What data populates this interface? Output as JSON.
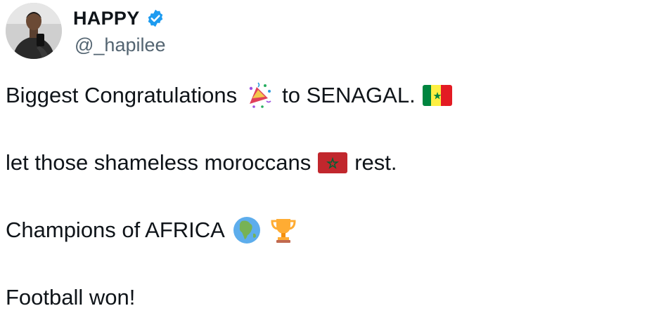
{
  "author": {
    "display_name": "HAPPY",
    "handle": "@_hapilee",
    "verified": true,
    "verified_color": "#1d9bf0"
  },
  "tweet": {
    "line1_before": "Biggest Congratulations",
    "line1_emoji": "party-popper-icon",
    "line1_after": "to SENAGAL.",
    "line1_flag": "senegal-flag-icon",
    "line2_before": "let those shameless moroccans",
    "line2_flag": "morocco-flag-icon",
    "line2_after": "rest.",
    "line3_text": "Champions of AFRICA",
    "line3_emoji_1": "globe-africa-icon",
    "line3_emoji_2": "trophy-icon",
    "line4_text": "Football won!"
  },
  "colors": {
    "text": "#0f1419",
    "secondary_text": "#536471"
  }
}
